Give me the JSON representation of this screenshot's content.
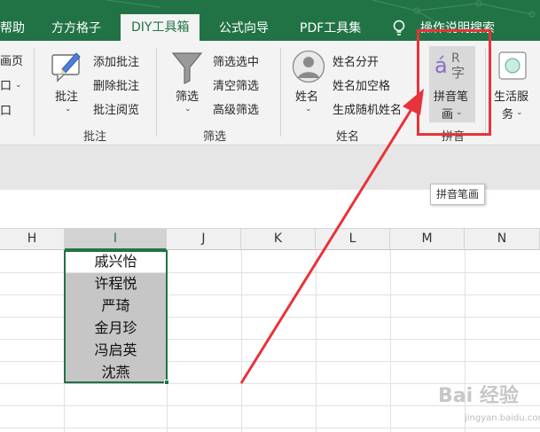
{
  "tabs": {
    "help": "帮助",
    "fangfang": "方方格子",
    "diy": "DIY工具箱",
    "formula_wizard": "公式向导",
    "pdf": "PDF工具集",
    "tell_me": "操作说明搜索"
  },
  "ribbon": {
    "left_partial": [
      "画页",
      "口",
      "口"
    ],
    "annotation_group": {
      "main_button": "批注",
      "items": [
        "添加批注",
        "删除批注",
        "批注阅览"
      ],
      "label": "批注"
    },
    "filter_group": {
      "main_button": "筛选",
      "items": [
        "筛选选中",
        "清空筛选",
        "高级筛选"
      ],
      "label": "筛选"
    },
    "name_group": {
      "main_button": "姓名",
      "items": [
        "姓名分开",
        "姓名加空格",
        "生成随机姓名"
      ],
      "label": "姓名"
    },
    "pinyin_group": {
      "button_line1": "拼音笔",
      "button_line2": "画",
      "label": "拼音"
    },
    "life_service": {
      "line1": "生活服",
      "line2": "务"
    }
  },
  "tooltip": "拼音笔画",
  "columns": [
    "H",
    "I",
    "J",
    "K",
    "L",
    "M",
    "N"
  ],
  "selected_column": "I",
  "cells": [
    "戚兴怡",
    "许程悦",
    "严琦",
    "金月珍",
    "冯启英",
    "沈燕"
  ],
  "watermark": {
    "text": "Bai 经验",
    "sub": "jingyan.baidu.com"
  },
  "colors": {
    "ribbon_green": "#217346",
    "annotation_red": "#e8333a",
    "selection_gray": "#c6c6c6"
  }
}
